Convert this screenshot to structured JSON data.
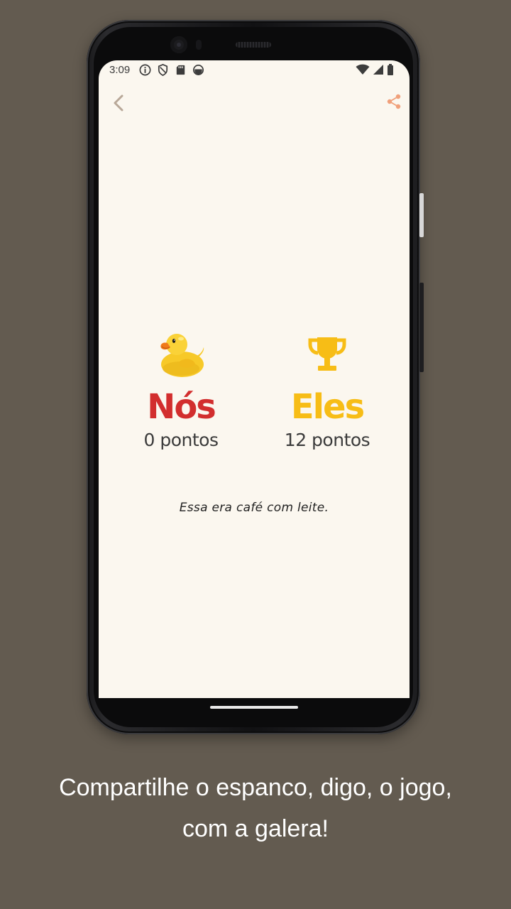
{
  "status_bar": {
    "time": "3:09"
  },
  "toolbar": {
    "back_icon": "chevron-left",
    "share_icon": "share",
    "accent_color": "#f0a07a",
    "back_color": "#b8a898"
  },
  "teams": [
    {
      "emoji": "🦆",
      "name": "Nós",
      "points": "0 pontos",
      "color": "#d22e2e"
    },
    {
      "icon": "trophy",
      "name": "Eles",
      "points": "12 pontos",
      "color": "#f7bd16"
    }
  ],
  "result_message": "Essa era café com leite.",
  "caption": "Compartilhe o espanco, digo, o jogo, com a galera!"
}
